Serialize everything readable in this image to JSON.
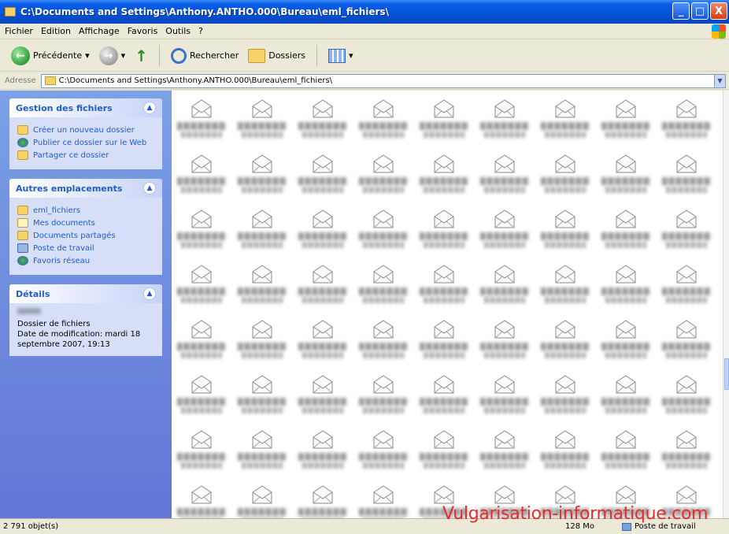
{
  "window": {
    "title": "C:\\Documents and Settings\\Anthony.ANTHO.000\\Bureau\\eml_fichiers\\",
    "controls": {
      "minimize": "_",
      "maximize": "□",
      "close": "X"
    }
  },
  "menubar": {
    "items": [
      "Fichier",
      "Edition",
      "Affichage",
      "Favoris",
      "Outils",
      "?"
    ]
  },
  "toolbar": {
    "back_label": "Précédente",
    "search_label": "Rechercher",
    "folders_label": "Dossiers",
    "icons": [
      "back-icon",
      "forward-icon",
      "up-icon",
      "search-icon",
      "folders-icon",
      "views-icon"
    ]
  },
  "address": {
    "label": "Adresse",
    "value": "C:\\Documents and Settings\\Anthony.ANTHO.000\\Bureau\\eml_fichiers\\"
  },
  "sidebar": {
    "file_tasks": {
      "title": "Gestion des fichiers",
      "items": [
        "Créer un nouveau dossier",
        "Publier ce dossier sur le Web",
        "Partager ce dossier"
      ]
    },
    "other_places": {
      "title": "Autres emplacements",
      "items": [
        "eml_fichiers",
        "Mes documents",
        "Documents partagés",
        "Poste de travail",
        "Favoris réseau"
      ]
    },
    "details": {
      "title": "Détails",
      "type": "Dossier de fichiers",
      "modified": "Date de modification: mardi 18 septembre 2007, 19:13"
    }
  },
  "content": {
    "item_icon": "email-message-icon",
    "visible_item_count": 72
  },
  "statusbar": {
    "count": "2 791 objet(s)",
    "size": "128 Mo",
    "location": "Poste de travail"
  },
  "watermark": "Vulgarisation-informatique.com",
  "colors": {
    "titlebar": "#0a5ce8",
    "taskpane": "#7aa1e6",
    "link": "#215dc6",
    "watermark": "#e62b2b"
  }
}
